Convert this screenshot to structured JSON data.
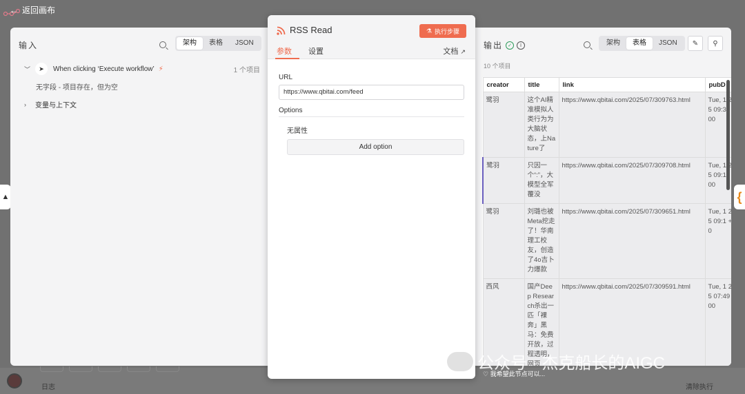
{
  "canvas": {
    "back_label": "返回画布",
    "log_label": "日志",
    "clear_label": "清除执行",
    "right_tab_glyph": "{"
  },
  "input_panel": {
    "title": "输入",
    "tabs": [
      "架构",
      "表格",
      "JSON"
    ],
    "active_tab": "架构",
    "trigger": {
      "name": "When clicking ‘Execute workflow’",
      "count": "1 个项目"
    },
    "empty_note": "无字段 - 项目存在，但为空",
    "vars_label": "变量与上下文"
  },
  "node": {
    "title": "RSS Read",
    "execute_label": "执行步骤",
    "tabs": [
      "参数",
      "设置"
    ],
    "active_tab": "参数",
    "docs_label": "文档",
    "url_label": "URL",
    "url_value": "https://www.qbitai.com/feed",
    "options_label": "Options",
    "no_props": "无属性",
    "add_option_label": "Add option"
  },
  "output_panel": {
    "title": "输出",
    "tabs": [
      "架构",
      "表格",
      "JSON"
    ],
    "active_tab": "表格",
    "items_count": "10 个项目",
    "columns": [
      "creator",
      "title",
      "link",
      "pubD"
    ],
    "rows": [
      {
        "creator": "鹭羽",
        "title": "这个AI精准模拟人类行为为大脑状态，上Nature了",
        "link": "https://www.qbitai.com/2025/07/309763.html",
        "pub": "Tue, 1 2025 09:37 +000"
      },
      {
        "creator": "鹭羽",
        "title": "只因一个“:”，大模型全军覆没",
        "link": "https://www.qbitai.com/2025/07/309708.html",
        "pub": "Tue, 1 2025 09:15 +000"
      },
      {
        "creator": "鹭羽",
        "title": "刘璐也被Meta挖走了！华南理工校友，创造了4o吉卜力爆款",
        "link": "https://www.qbitai.com/2025/07/309651.html",
        "pub": "Tue, 1 2025 09:1 +000"
      },
      {
        "creator": "西风",
        "title": "国产Deep Research杀出一匹「裸奔」黑马：免费开放，过程透明，网页",
        "link": "https://www.qbitai.com/2025/07/309591.html",
        "pub": "Tue, 1 2025 07:49 +000"
      }
    ]
  },
  "overlay": {
    "watermark": "公众号 · 杰克船长的AIGC",
    "feedback": "我希望此节点可以..."
  },
  "colors": {
    "accent": "#ef6c4f",
    "success": "#2e9c5c",
    "highlight_row": "#6b5fbf"
  }
}
